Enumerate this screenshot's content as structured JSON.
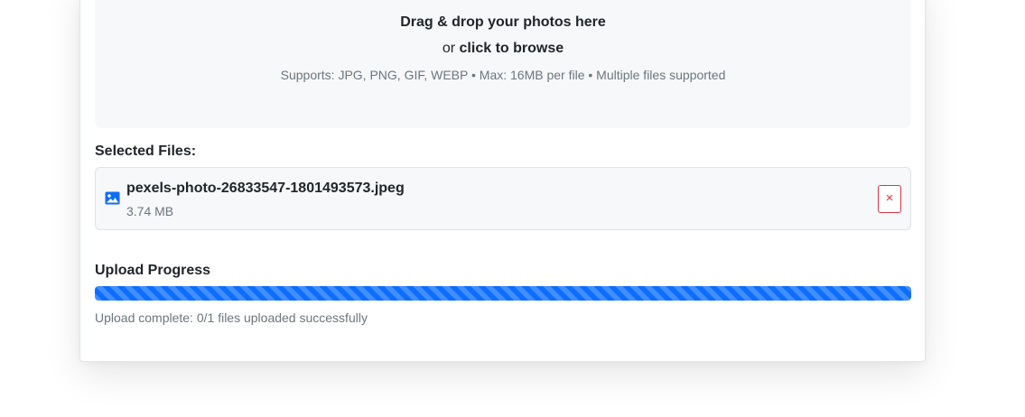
{
  "dropzone": {
    "title": "Drag & drop your photos here",
    "or_text": "or ",
    "browse_label": "click to browse",
    "supports_text": "Supports: JPG, PNG, GIF, WEBP • Max: 16MB per file • Multiple files supported"
  },
  "selected_files": {
    "heading": "Selected Files:",
    "items": [
      {
        "name": "pexels-photo-26833547-1801493573.jpeg",
        "size": "3.74 MB",
        "icon": "image-icon",
        "remove_label": "×"
      }
    ]
  },
  "upload_progress": {
    "heading": "Upload Progress",
    "percent": 100,
    "status": "Upload complete: 0/1 files uploaded successfully"
  },
  "colors": {
    "accent": "#0d6efd",
    "danger": "#dc3545",
    "muted": "#6c757d",
    "surface": "#f7f8fa"
  }
}
